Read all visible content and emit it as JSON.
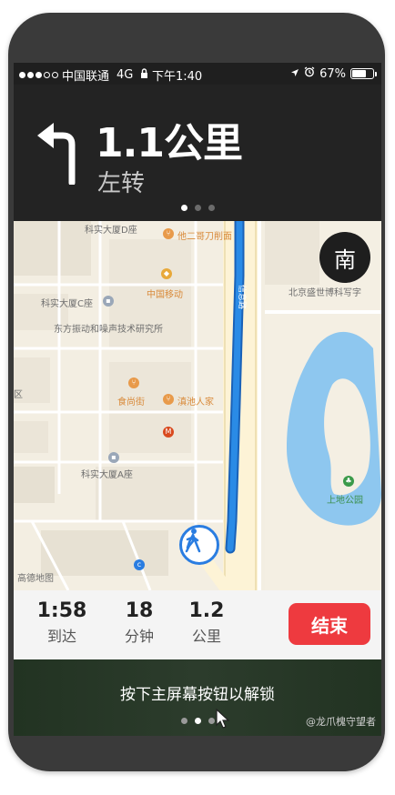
{
  "status_bar": {
    "carrier": "中国联通",
    "network": "4G",
    "time": "下午1:40",
    "battery_percent": "67%",
    "battery_level": 0.67
  },
  "navigation": {
    "distance": "1.1公里",
    "instruction": "左转",
    "pages": 3,
    "active_page": 0
  },
  "map": {
    "compass": "南",
    "pois": {
      "building_d": "科实大厦D座",
      "tazhe": "他二哥刀削面",
      "china_mobile": "中国移动",
      "building_c": "科实大厦C座",
      "institute": "东方振动和噪声技术研究所",
      "shishangjie": "食尚街",
      "dianchi": "滇池人家",
      "building_a": "科实大厦A座",
      "beijing_school": "北京盛世博科写字",
      "park": "上地公园",
      "district": "区",
      "gaode": "高德地图",
      "road": "信息路"
    }
  },
  "trip": {
    "arrival_time": "1:58",
    "arrival_label": "到达",
    "minutes": "18",
    "minutes_label": "分钟",
    "distance": "1.2",
    "distance_label": "公里",
    "end_button": "结束"
  },
  "lock": {
    "unlock_text": "按下主屏幕按钮以解锁",
    "watermark": "@龙爪槐守望者"
  },
  "colors": {
    "route": "#2a8be6",
    "end_button": "#ee3a3f",
    "water": "#8ec7ef",
    "map_bg": "#f3eee2"
  }
}
